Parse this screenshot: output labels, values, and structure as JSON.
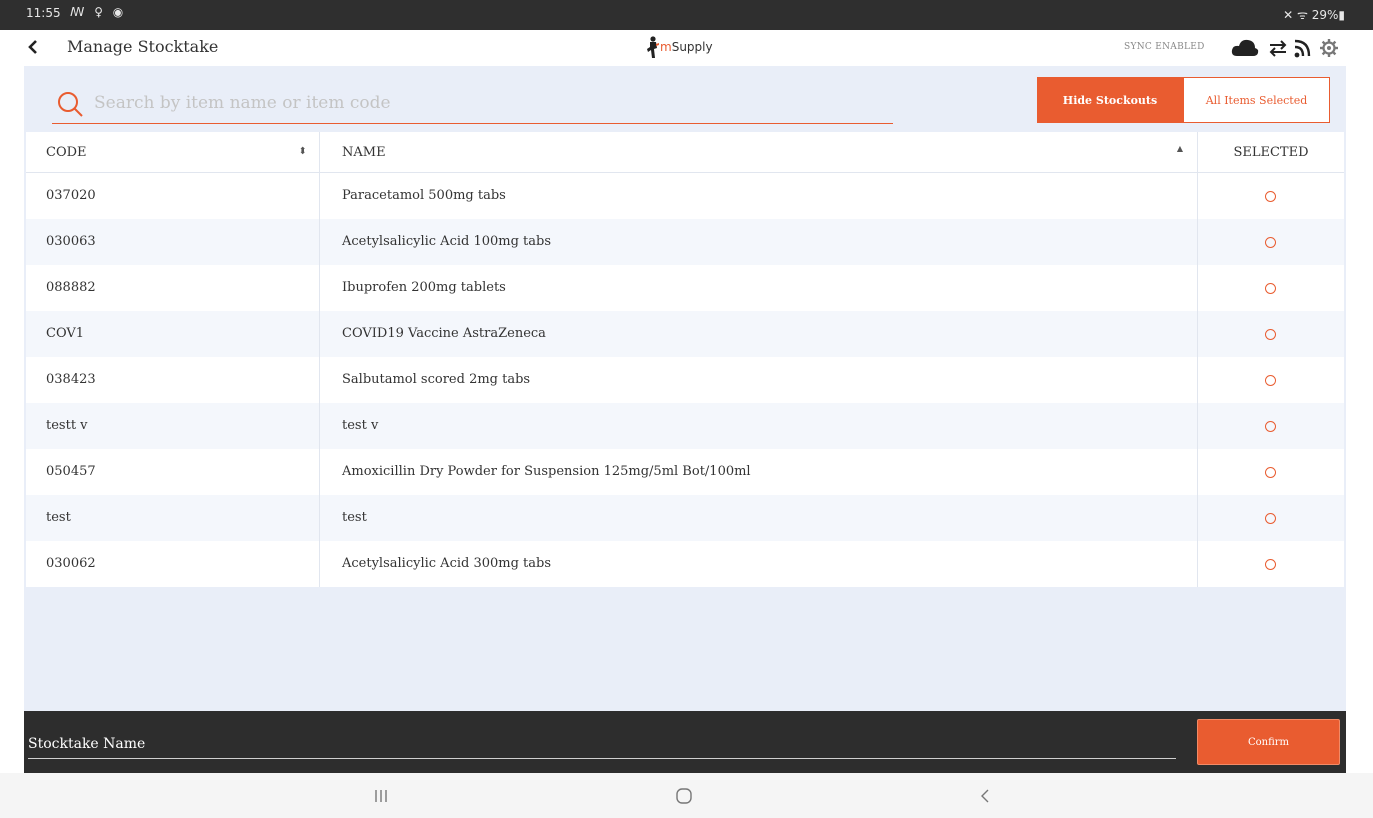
{
  "status_bar": {
    "time": "11:55",
    "left_icons": "ꟿ ♀ ◉",
    "right_icons": "✕ ᯤ 29%▮"
  },
  "header": {
    "title": "Manage Stocktake",
    "logo_text_m": "m",
    "logo_text_rest": "Supply",
    "sync_status": "SYNC ENABLED",
    "icons": [
      "cloud-icon",
      "sync-arrows-icon",
      "rss-icon",
      "gear-icon"
    ]
  },
  "search": {
    "placeholder": "Search by item name or item code",
    "value": ""
  },
  "toolbar": {
    "hide_stockouts_label": "Hide Stockouts",
    "all_items_label": "All Items Selected"
  },
  "table": {
    "columns": {
      "code": "CODE",
      "name": "NAME",
      "selected": "SELECTED"
    },
    "rows": [
      {
        "code": "037020",
        "name": "Paracetamol 500mg tabs",
        "selected": false
      },
      {
        "code": "030063",
        "name": "Acetylsalicylic Acid 100mg tabs",
        "selected": false
      },
      {
        "code": "088882",
        "name": "Ibuprofen 200mg tablets",
        "selected": false
      },
      {
        "code": "COV1",
        "name": "COVID19 Vaccine AstraZeneca",
        "selected": false
      },
      {
        "code": "038423",
        "name": "Salbutamol scored 2mg tabs",
        "selected": false
      },
      {
        "code": "testt v",
        "name": "test v",
        "selected": false
      },
      {
        "code": "050457",
        "name": "Amoxicillin Dry Powder for Suspension 125mg/5ml Bot/100ml",
        "selected": false
      },
      {
        "code": "test",
        "name": "test",
        "selected": false
      },
      {
        "code": "030062",
        "name": "Acetylsalicylic Acid 300mg tabs",
        "selected": false
      }
    ]
  },
  "footer": {
    "stocktake_name_value": "Stocktake Name",
    "confirm_label": "Confirm"
  },
  "colors": {
    "accent": "#e95c30",
    "panel_bg": "#e9eef8",
    "footer_bg": "#2d2d2d"
  }
}
